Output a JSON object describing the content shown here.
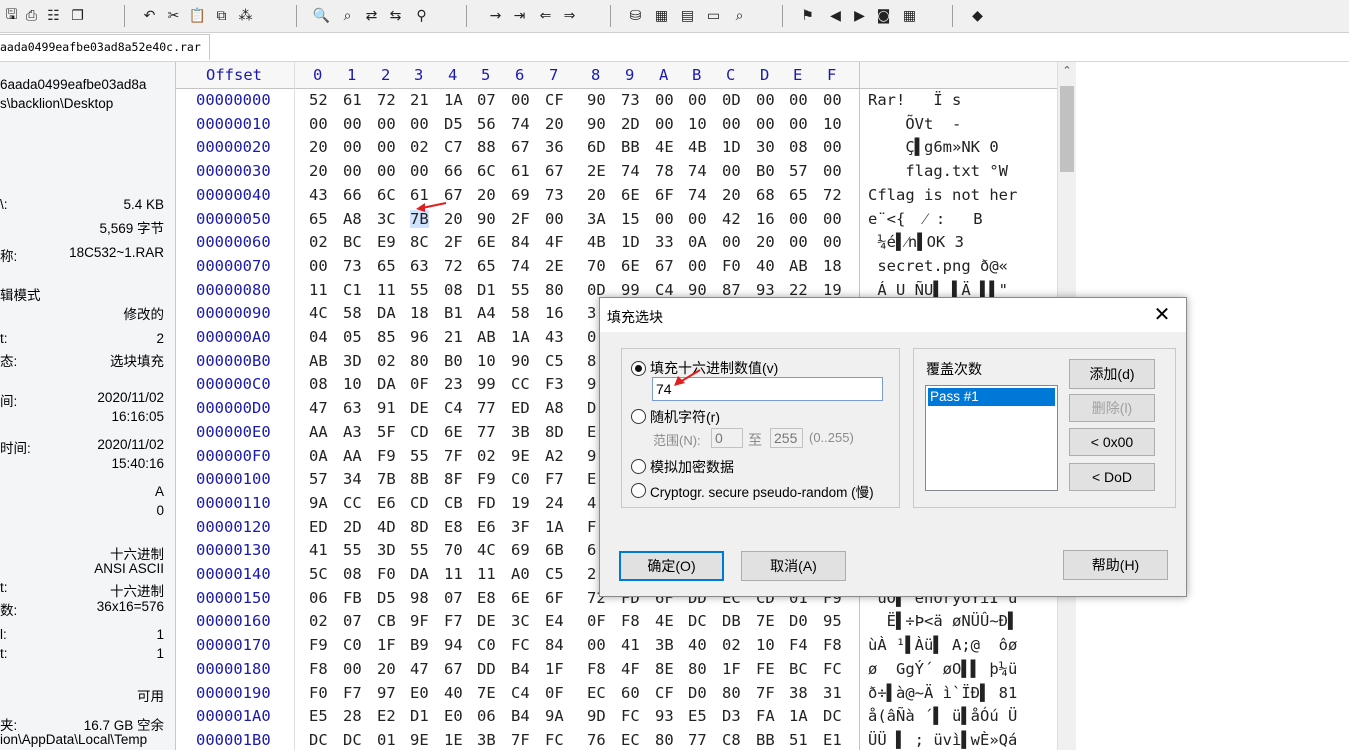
{
  "tab": {
    "filename": "aada0499eafbe03ad8a52e40c.rar"
  },
  "toolbar": {
    "icons": [
      "save-icon",
      "print-icon",
      "properties-icon",
      "copy-icon",
      "undo-icon",
      "cut-icon",
      "paste-icon",
      "copy-block-icon",
      "hex-icon",
      "find-icon",
      "find-hex-icon",
      "replace-icon",
      "replace-hex-icon",
      "find-next-icon",
      "arrow-right-icon",
      "goto-offset-icon",
      "back-icon",
      "forward-icon",
      "disk-icon",
      "ram-icon",
      "calculator-icon",
      "screen-icon",
      "magnifier-icon",
      "stamp-icon",
      "prev-icon",
      "next-icon",
      "camera-icon",
      "grid-icon",
      "book-icon"
    ]
  },
  "info_panel": {
    "name_line1": "6aada0499eafbe03ad8a",
    "name_line2": "s\\backlion\\Desktop",
    "rows": [
      {
        "label": "\\:",
        "value": "5.4 KB"
      },
      {
        "label": "",
        "value": "5,569 字节"
      },
      {
        "label": "称:",
        "value": "18C532~1.RAR"
      },
      {
        "label": "辑模式",
        "value": ""
      },
      {
        "label": "",
        "value": "修改的"
      },
      {
        "label": "t:",
        "value": "2"
      },
      {
        "label": "态:",
        "value": "选块填充"
      },
      {
        "label": "间:",
        "value": "2020/11/02"
      },
      {
        "label": "",
        "value": "16:16:05"
      },
      {
        "label": "时间:",
        "value": "2020/11/02"
      },
      {
        "label": "",
        "value": "15:40:16"
      },
      {
        "label": "",
        "value": "A"
      },
      {
        "label": "",
        "value": "0"
      },
      {
        "label": "",
        "value": "十六进制"
      },
      {
        "label": "",
        "value": "ANSI ASCII"
      },
      {
        "label": "t:",
        "value": "十六进制"
      },
      {
        "label": "数:",
        "value": "36x16=576"
      },
      {
        "label": "l:",
        "value": "1"
      },
      {
        "label": "t:",
        "value": "1"
      },
      {
        "label": "",
        "value": "可用"
      },
      {
        "label": "夹:",
        "value": "16.7 GB 空余"
      },
      {
        "label": "ion\\AppData\\Local\\Temp",
        "value": ""
      }
    ]
  },
  "hex": {
    "header_offset": "Offset",
    "columns": [
      "0",
      "1",
      "2",
      "3",
      "4",
      "5",
      "6",
      "7",
      "8",
      "9",
      "A",
      "B",
      "C",
      "D",
      "E",
      "F"
    ],
    "selected": {
      "row": 5,
      "col": 3
    },
    "rows": [
      {
        "offset": "00000000",
        "bytes": [
          "52",
          "61",
          "72",
          "21",
          "1A",
          "07",
          "00",
          "CF",
          "90",
          "73",
          "00",
          "00",
          "0D",
          "00",
          "00",
          "00"
        ],
        "ascii": "Rar!   Ï s"
      },
      {
        "offset": "00000010",
        "bytes": [
          "00",
          "00",
          "00",
          "00",
          "D5",
          "56",
          "74",
          "20",
          "90",
          "2D",
          "00",
          "10",
          "00",
          "00",
          "00",
          "10"
        ],
        "ascii": "    ÕVt  -"
      },
      {
        "offset": "00000020",
        "bytes": [
          "20",
          "00",
          "00",
          "02",
          "C7",
          "88",
          "67",
          "36",
          "6D",
          "BB",
          "4E",
          "4B",
          "1D",
          "30",
          "08",
          "00"
        ],
        "ascii": "    Ç▌g6m»NK 0"
      },
      {
        "offset": "00000030",
        "bytes": [
          "20",
          "00",
          "00",
          "00",
          "66",
          "6C",
          "61",
          "67",
          "2E",
          "74",
          "78",
          "74",
          "00",
          "B0",
          "57",
          "00"
        ],
        "ascii": "    flag.txt °W"
      },
      {
        "offset": "00000040",
        "bytes": [
          "43",
          "66",
          "6C",
          "61",
          "67",
          "20",
          "69",
          "73",
          "20",
          "6E",
          "6F",
          "74",
          "20",
          "68",
          "65",
          "72"
        ],
        "ascii": "Cflag is not her"
      },
      {
        "offset": "00000050",
        "bytes": [
          "65",
          "A8",
          "3C",
          "7B",
          "20",
          "90",
          "2F",
          "00",
          "3A",
          "15",
          "00",
          "00",
          "42",
          "16",
          "00",
          "00"
        ],
        "ascii": "e¨<{  ⁄ :   B"
      },
      {
        "offset": "00000060",
        "bytes": [
          "02",
          "BC",
          "E9",
          "8C",
          "2F",
          "6E",
          "84",
          "4F",
          "4B",
          "1D",
          "33",
          "0A",
          "00",
          "20",
          "00",
          "00"
        ],
        "ascii": " ¼é▌⁄n▌OK 3"
      },
      {
        "offset": "00000070",
        "bytes": [
          "00",
          "73",
          "65",
          "63",
          "72",
          "65",
          "74",
          "2E",
          "70",
          "6E",
          "67",
          "00",
          "F0",
          "40",
          "AB",
          "18"
        ],
        "ascii": " secret.png ð@«"
      },
      {
        "offset": "00000080",
        "bytes": [
          "11",
          "C1",
          "11",
          "55",
          "08",
          "D1",
          "55",
          "80",
          "0D",
          "99",
          "C4",
          "90",
          "87",
          "93",
          "22",
          "19"
        ],
        "ascii": " Á U ÑU▌ ▌Ä ▌▌\""
      },
      {
        "offset": "00000090",
        "bytes": [
          "4C",
          "58",
          "DA",
          "18",
          "B1",
          "A4",
          "58",
          "16",
          "3",
          "",
          "",
          "",
          "",
          "",
          "",
          ""
        ],
        "ascii": ""
      },
      {
        "offset": "000000A0",
        "bytes": [
          "04",
          "05",
          "85",
          "96",
          "21",
          "AB",
          "1A",
          "43",
          "0",
          "",
          "",
          "",
          "",
          "",
          "",
          ""
        ],
        "ascii": ""
      },
      {
        "offset": "000000B0",
        "bytes": [
          "AB",
          "3D",
          "02",
          "80",
          "B0",
          "10",
          "90",
          "C5",
          "8",
          "",
          "",
          "",
          "",
          "",
          "",
          ""
        ],
        "ascii": ""
      },
      {
        "offset": "000000C0",
        "bytes": [
          "08",
          "10",
          "DA",
          "0F",
          "23",
          "99",
          "CC",
          "F3",
          "9",
          "",
          "",
          "",
          "",
          "",
          "",
          ""
        ],
        "ascii": ""
      },
      {
        "offset": "000000D0",
        "bytes": [
          "47",
          "63",
          "91",
          "DE",
          "C4",
          "77",
          "ED",
          "A8",
          "D",
          "",
          "",
          "",
          "",
          "",
          "",
          ""
        ],
        "ascii": ""
      },
      {
        "offset": "000000E0",
        "bytes": [
          "AA",
          "A3",
          "5F",
          "CD",
          "6E",
          "77",
          "3B",
          "8D",
          "E",
          "",
          "",
          "",
          "",
          "",
          "",
          ""
        ],
        "ascii": ""
      },
      {
        "offset": "000000F0",
        "bytes": [
          "0A",
          "AA",
          "F9",
          "55",
          "7F",
          "02",
          "9E",
          "A2",
          "9",
          "",
          "",
          "",
          "",
          "",
          "",
          ""
        ],
        "ascii": ""
      },
      {
        "offset": "00000100",
        "bytes": [
          "57",
          "34",
          "7B",
          "8B",
          "8F",
          "F9",
          "C0",
          "F7",
          "E",
          "",
          "",
          "",
          "",
          "",
          "",
          ""
        ],
        "ascii": ""
      },
      {
        "offset": "00000110",
        "bytes": [
          "9A",
          "CC",
          "E6",
          "CD",
          "CB",
          "FD",
          "19",
          "24",
          "4",
          "",
          "",
          "",
          "",
          "",
          "",
          ""
        ],
        "ascii": ""
      },
      {
        "offset": "00000120",
        "bytes": [
          "ED",
          "2D",
          "4D",
          "8D",
          "E8",
          "E6",
          "3F",
          "1A",
          "F",
          "",
          "",
          "",
          "",
          "",
          "",
          ""
        ],
        "ascii": ""
      },
      {
        "offset": "00000130",
        "bytes": [
          "41",
          "55",
          "3D",
          "55",
          "70",
          "4C",
          "69",
          "6B",
          "6",
          "",
          "",
          "",
          "",
          "",
          "",
          ""
        ],
        "ascii": ""
      },
      {
        "offset": "00000140",
        "bytes": [
          "5C",
          "08",
          "F0",
          "DA",
          "11",
          "11",
          "A0",
          "C5",
          "2",
          "",
          "",
          "",
          "",
          "",
          "",
          ""
        ],
        "ascii": ""
      },
      {
        "offset": "00000150",
        "bytes": [
          "06",
          "FB",
          "D5",
          "98",
          "07",
          "E8",
          "6E",
          "6F",
          "72",
          "FD",
          "6F",
          "DD",
          "EC",
          "CD",
          "01",
          "F9"
        ],
        "ascii": " ûÕ▌ ènoryoÝìÍ ù"
      },
      {
        "offset": "00000160",
        "bytes": [
          "02",
          "07",
          "CB",
          "9F",
          "F7",
          "DE",
          "3C",
          "E4",
          "0F",
          "F8",
          "4E",
          "DC",
          "DB",
          "7E",
          "D0",
          "95"
        ],
        "ascii": "  Ë▌÷Þ<ä øNÜÛ~Ð▌"
      },
      {
        "offset": "00000170",
        "bytes": [
          "F9",
          "C0",
          "1F",
          "B9",
          "94",
          "C0",
          "FC",
          "84",
          "00",
          "41",
          "3B",
          "40",
          "02",
          "10",
          "F4",
          "F8"
        ],
        "ascii": "ùÀ ¹▌Àü▌ A;@  ôø"
      },
      {
        "offset": "00000180",
        "bytes": [
          "F8",
          "00",
          "20",
          "47",
          "67",
          "DD",
          "B4",
          "1F",
          "F8",
          "4F",
          "8E",
          "80",
          "1F",
          "FE",
          "BC",
          "FC"
        ],
        "ascii": "ø  GgÝ´ øO▌▌ þ¼ü"
      },
      {
        "offset": "00000190",
        "bytes": [
          "F0",
          "F7",
          "97",
          "E0",
          "40",
          "7E",
          "C4",
          "0F",
          "EC",
          "60",
          "CF",
          "D0",
          "80",
          "7F",
          "38",
          "31"
        ],
        "ascii": "ð÷▌à@~Ä ì`ÏÐ▌ 81"
      },
      {
        "offset": "000001A0",
        "bytes": [
          "E5",
          "28",
          "E2",
          "D1",
          "E0",
          "06",
          "B4",
          "9A",
          "9D",
          "FC",
          "93",
          "E5",
          "D3",
          "FA",
          "1A",
          "DC"
        ],
        "ascii": "å(âÑà ´▌ ü▌åÓú Ü"
      },
      {
        "offset": "000001B0",
        "bytes": [
          "DC",
          "DC",
          "01",
          "9E",
          "1E",
          "3B",
          "7F",
          "FC",
          "76",
          "EC",
          "80",
          "77",
          "C8",
          "BB",
          "51",
          "E1"
        ],
        "ascii": "ÜÜ ▌ ; üvì▌wÈ»Qá"
      }
    ]
  },
  "dialog": {
    "title": "填充选块",
    "close": "✕",
    "opt_hex_label": "填充十六进制数值(v)",
    "hex_value": "74",
    "opt_random_label": "随机字符(r)",
    "range_label": "范围(N):",
    "range_from": "0",
    "range_to_label": "至",
    "range_to": "255",
    "range_hint": "(0..255)",
    "opt_sim_label": "模拟加密数据",
    "opt_crypto_label": "Cryptogr. secure pseudo-random (慢)",
    "passes_label": "覆盖次数",
    "pass_item": "Pass #1",
    "add_label": "添加(d)",
    "delete_label": "删除(l)",
    "zero_label": "< 0x00",
    "dod_label": "< DoD",
    "ok_label": "确定(O)",
    "cancel_label": "取消(A)",
    "help_label": "帮助(H)"
  }
}
